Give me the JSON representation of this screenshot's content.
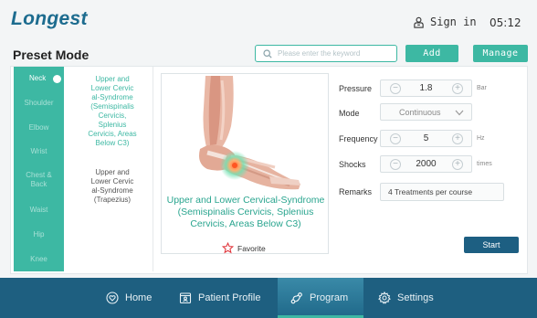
{
  "header": {
    "logo": "Longest",
    "sign_in": "Sign in",
    "time": "05:12"
  },
  "page": {
    "title": "Preset Mode"
  },
  "search": {
    "placeholder": "Please enter the keyword"
  },
  "toolbar": {
    "add_label": "Add",
    "manage_label": "Manage"
  },
  "sidebar": {
    "items": [
      {
        "label": "Neck",
        "active": true
      },
      {
        "label": "Shoulder"
      },
      {
        "label": "Elbow"
      },
      {
        "label": "Wrist"
      },
      {
        "label": "Chest &\nBack"
      },
      {
        "label": "Waist"
      },
      {
        "label": "Hip"
      },
      {
        "label": "Knee"
      }
    ]
  },
  "protocols": {
    "items": [
      {
        "label": "Upper and\nLower Cervic\nal-Syndrome\n(Semispinalis\nCervicis,\nSplenius\nCervicis, Areas\nBelow C3)",
        "active": true
      },
      {
        "label": "Upper and\nLower Cervic\nal-Syndrome\n(Trapezius)"
      }
    ]
  },
  "card": {
    "title": "Upper and Lower Cervical-Syndrome\n(Semispinalis Cervicis, Splenius\nCervicis, Areas Below C3)",
    "favorite_label": "Favorite"
  },
  "params": {
    "pressure": {
      "label": "Pressure",
      "value": "1.8",
      "unit": "Bar"
    },
    "mode": {
      "label": "Mode",
      "value": "Continuous"
    },
    "frequency": {
      "label": "Frequency",
      "value": "5",
      "unit": "Hz"
    },
    "shocks": {
      "label": "Shocks",
      "value": "2000",
      "unit": "times"
    },
    "remarks": {
      "label": "Remarks",
      "value": "4 Treatments per course"
    }
  },
  "start_label": "Start",
  "nav": {
    "home": "Home",
    "patient": "Patient Profile",
    "program": "Program",
    "settings": "Settings"
  },
  "colors": {
    "accent": "#3db8a3",
    "brand": "#1d6c8f",
    "nav_bg": "#1e5f80",
    "start": "#1d5f82"
  }
}
